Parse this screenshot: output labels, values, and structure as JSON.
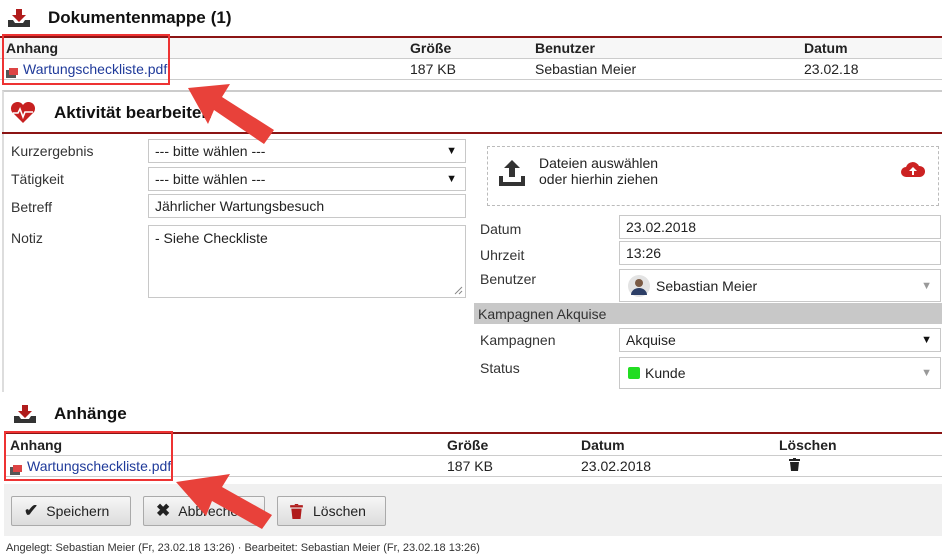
{
  "docfolder": {
    "title": "Dokumentenmappe",
    "count": "(1)",
    "columns": {
      "attachment": "Anhang",
      "size": "Größe",
      "user": "Benutzer",
      "date": "Datum"
    },
    "row": {
      "file": "Wartungscheckliste.pdf",
      "size": "187 KB",
      "user": "Sebastian Meier",
      "date": "23.02.18"
    }
  },
  "activity": {
    "title": "Aktivität bearbeiten",
    "labels": {
      "kurzergebnis": "Kurzergebnis",
      "taetigkeit": "Tätigkeit",
      "betreff": "Betreff",
      "notiz": "Notiz",
      "datum": "Datum",
      "uhrzeit": "Uhrzeit",
      "benutzer": "Benutzer",
      "kampagnen": "Kampagnen",
      "status": "Status"
    },
    "values": {
      "kurzergebnis": "--- bitte wählen ---",
      "taetigkeit": "--- bitte wählen ---",
      "betreff": "Jährlicher Wartungsbesuch",
      "notiz": "- Siehe Checkliste",
      "datum": "23.02.2018",
      "uhrzeit": "13:26",
      "benutzer": "Sebastian Meier",
      "kampagnen": "Akquise",
      "status": "Kunde"
    },
    "upload": {
      "line1": "Dateien auswählen",
      "line2": "oder hierhin ziehen"
    },
    "campaign_section": "Kampagnen Akquise",
    "status_color": "#22dd22"
  },
  "attachments": {
    "title": "Anhänge",
    "columns": {
      "attachment": "Anhang",
      "size": "Größe",
      "date": "Datum",
      "delete": "Löschen"
    },
    "row": {
      "file": "Wartungscheckliste.pdf",
      "size": "187 KB",
      "date": "23.02.2018"
    }
  },
  "buttons": {
    "save": "Speichern",
    "cancel": "Abbrechen",
    "delete": "Löschen"
  },
  "footer": "Angelegt: Sebastian Meier (Fr, 23.02.18 13:26) · Bearbeitet: Sebastian Meier (Fr, 23.02.18 13:26)",
  "colors": {
    "accent_red": "#8b1414",
    "arrow": "#e8413a",
    "link": "#1f3a9a"
  }
}
